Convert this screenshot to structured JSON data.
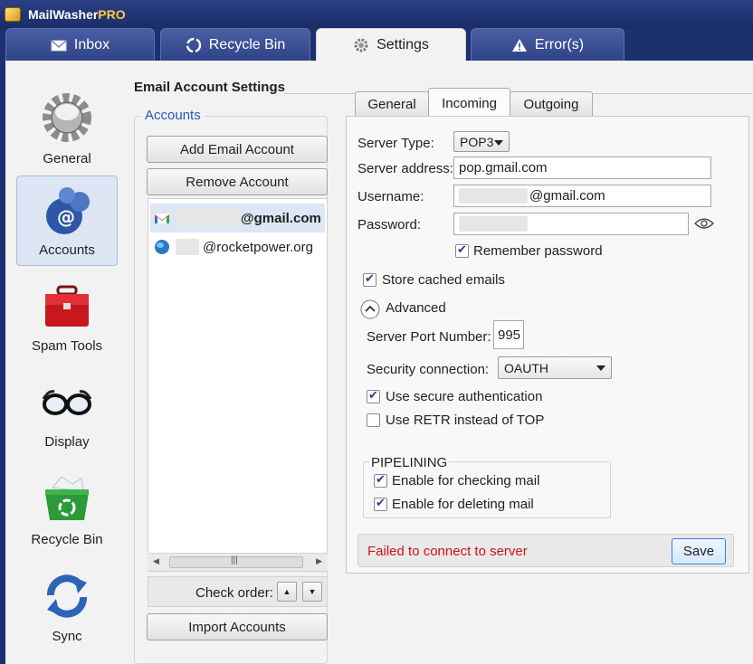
{
  "app": {
    "name": "MailWasher",
    "name_suffix": "PRO"
  },
  "main_tabs": [
    {
      "label": "Inbox",
      "icon": "envelope-icon"
    },
    {
      "label": "Recycle Bin",
      "icon": "recycle-icon"
    },
    {
      "label": "Settings",
      "icon": "gear-icon",
      "active": true
    },
    {
      "label": "Error(s)",
      "icon": "warning-icon"
    }
  ],
  "nav": [
    {
      "label": "General",
      "icon": "gear-icon"
    },
    {
      "label": "Accounts",
      "icon": "accounts-icon",
      "selected": true
    },
    {
      "label": "Spam Tools",
      "icon": "toolbox-icon"
    },
    {
      "label": "Display",
      "icon": "glasses-icon"
    },
    {
      "label": "Recycle Bin",
      "icon": "recycle-bin-icon"
    },
    {
      "label": "Sync",
      "icon": "sync-icon"
    }
  ],
  "section_title": "Email Account Settings",
  "accounts": {
    "legend": "Accounts",
    "add_label": "Add Email Account",
    "remove_label": "Remove Account",
    "items": [
      {
        "email": "@gmail.com",
        "icon": "gmail-icon",
        "selected": true
      },
      {
        "email": "@rocketpower.org",
        "icon": "globe-icon"
      }
    ],
    "check_order_label": "Check order:",
    "import_label": "Import Accounts"
  },
  "settings_tabs": [
    "General",
    "Incoming",
    "Outgoing"
  ],
  "incoming": {
    "server_type_label": "Server Type:",
    "server_type_value": "POP3",
    "server_address_label": "Server address:",
    "server_address_value": "pop.gmail.com",
    "username_label": "Username:",
    "username_value": "@gmail.com",
    "password_label": "Password:",
    "remember_password_label": "Remember password",
    "remember_password_checked": true,
    "store_cached_label": "Store cached emails",
    "store_cached_checked": true,
    "advanced_label": "Advanced",
    "port_label": "Server Port Number:",
    "port_value": "995",
    "security_label": "Security connection:",
    "security_value": "OAUTH",
    "secure_auth_label": "Use secure authentication",
    "secure_auth_checked": true,
    "retr_label": "Use RETR instead of TOP",
    "retr_checked": false,
    "pipelining_label": "PIPELINING",
    "pipe_checking_label": "Enable for checking mail",
    "pipe_checking_checked": true,
    "pipe_deleting_label": "Enable for deleting mail",
    "pipe_deleting_checked": true
  },
  "status": {
    "message": "Failed to connect to server",
    "save_label": "Save"
  },
  "colors": {
    "error": "#d0111b",
    "link_blue": "#2a56b8",
    "title_bar": "#1c2f6e"
  }
}
